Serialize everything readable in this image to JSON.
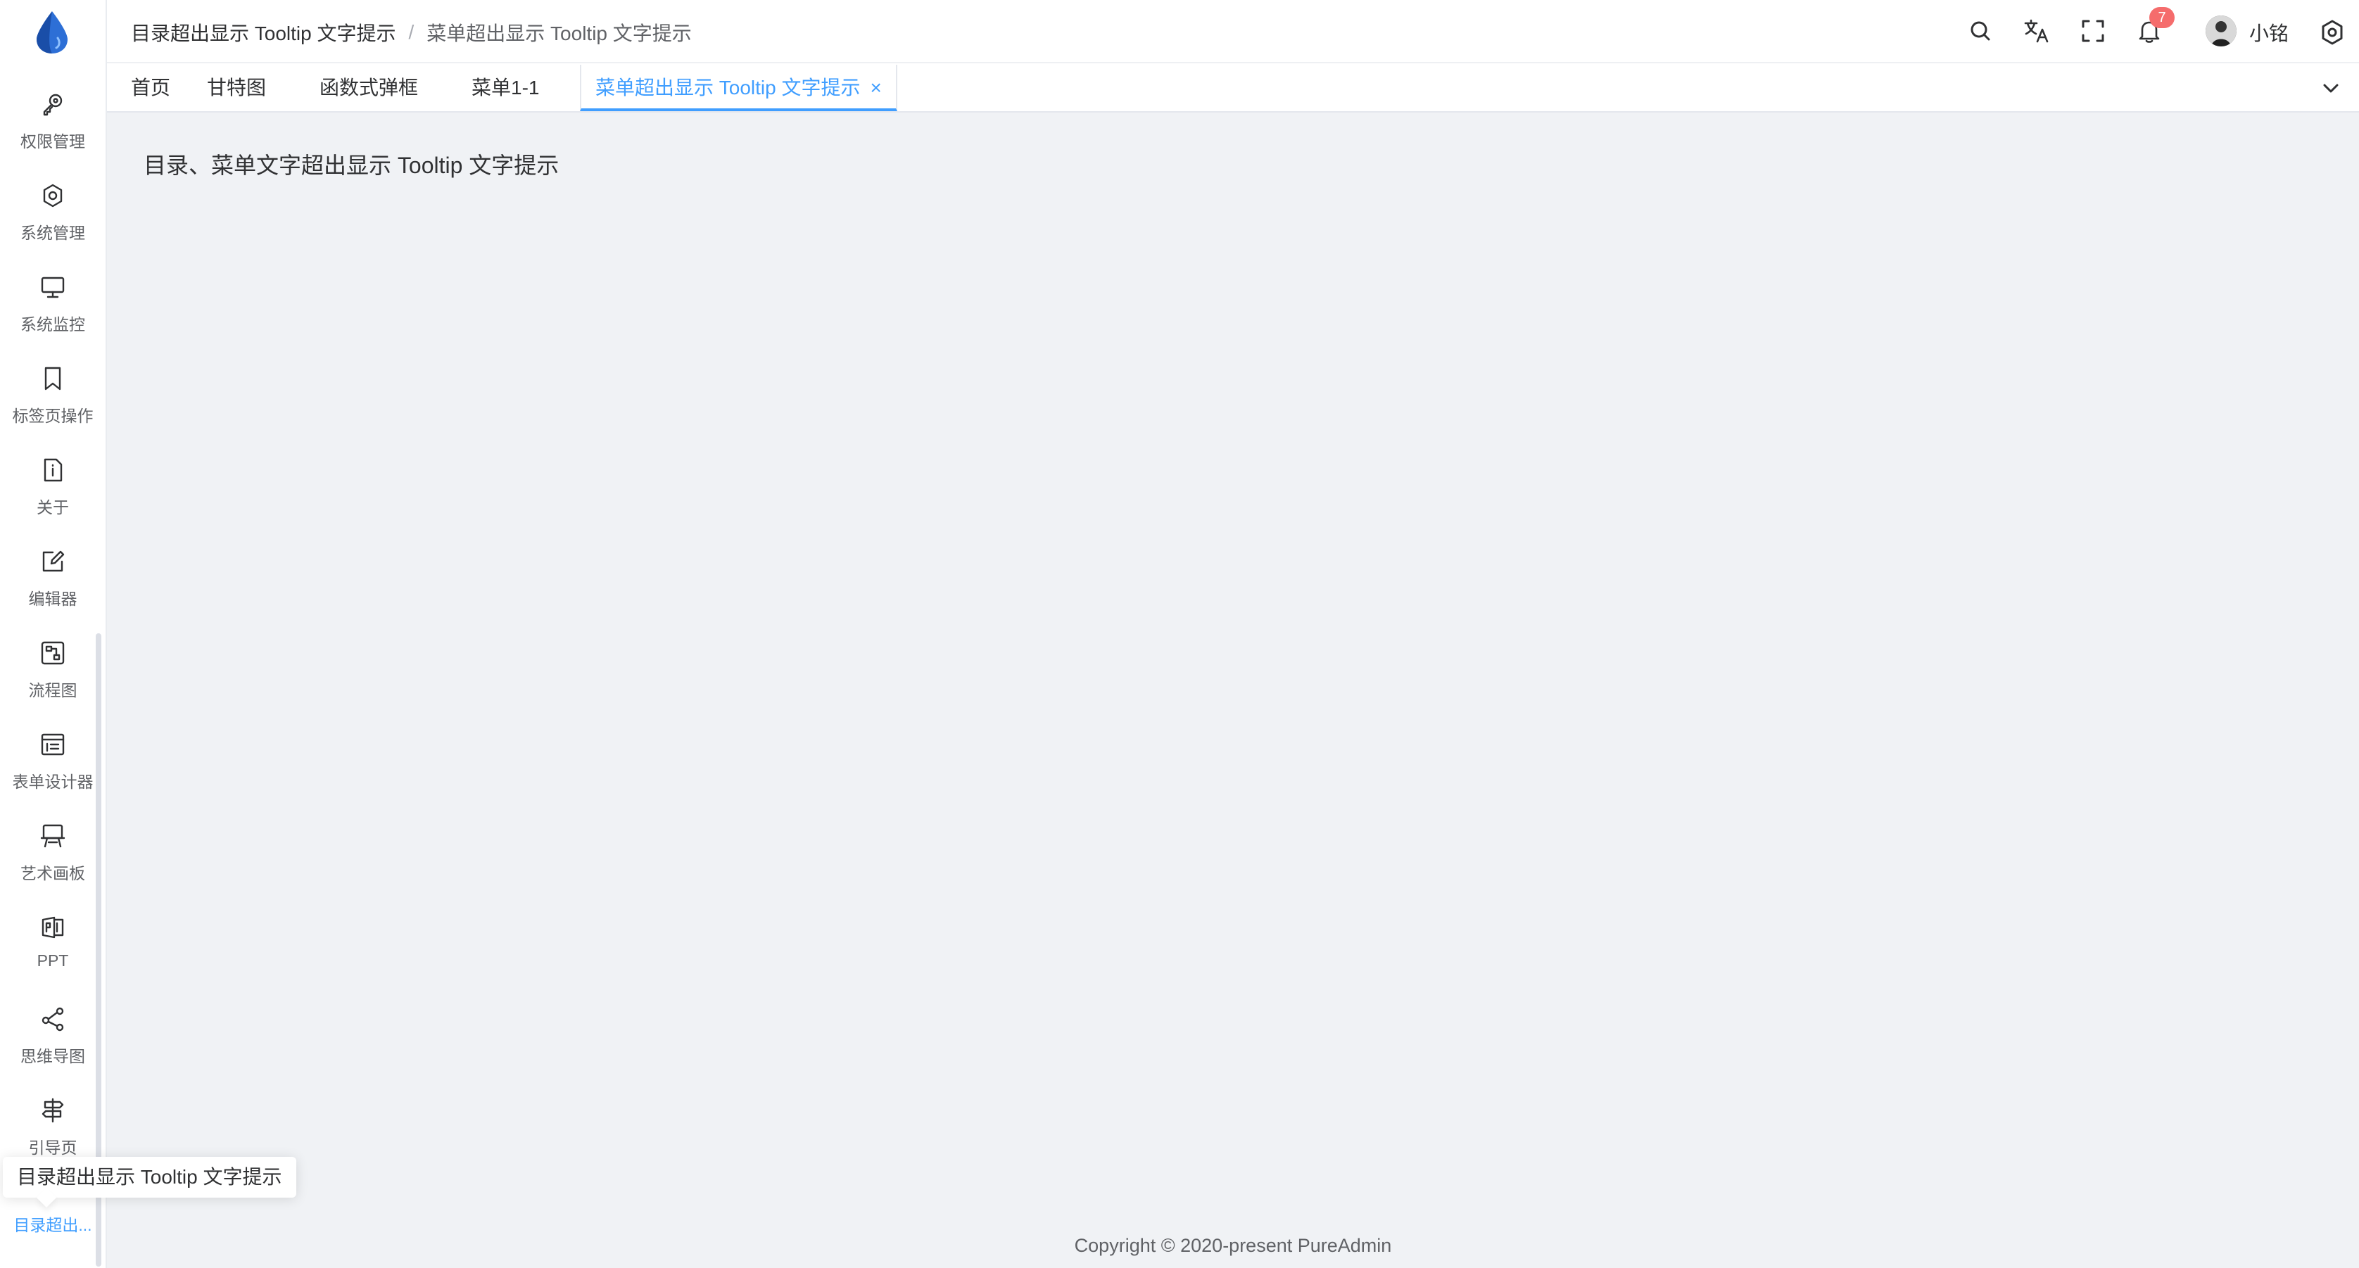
{
  "sidebar": {
    "items": [
      {
        "label": "权限管理",
        "icon": "key-icon"
      },
      {
        "label": "系统管理",
        "icon": "gear-icon"
      },
      {
        "label": "系统监控",
        "icon": "monitor-icon"
      },
      {
        "label": "标签页操作",
        "icon": "bookmark-icon"
      },
      {
        "label": "关于",
        "icon": "info-file-icon"
      },
      {
        "label": "编辑器",
        "icon": "edit-icon"
      },
      {
        "label": "流程图",
        "icon": "flow-icon"
      },
      {
        "label": "表单设计器",
        "icon": "form-icon"
      },
      {
        "label": "艺术画板",
        "icon": "easel-icon"
      },
      {
        "label": "PPT",
        "icon": "ppt-icon"
      },
      {
        "label": "思维导图",
        "icon": "mindmap-icon"
      },
      {
        "label": "引导页",
        "icon": "signpost-icon"
      },
      {
        "label": "目录超出...",
        "icon": "none"
      }
    ]
  },
  "navbar": {
    "breadcrumb": [
      "目录超出显示 Tooltip 文字提示",
      "菜单超出显示 Tooltip 文字提示"
    ],
    "separator": "/",
    "notification_count": "7",
    "username": "小铭"
  },
  "tabs": [
    {
      "label": "首页"
    },
    {
      "label": "甘特图"
    },
    {
      "label": "函数式弹框"
    },
    {
      "label": "菜单1-1"
    },
    {
      "label": "菜单超出显示 Tooltip 文字提示",
      "close": "×"
    }
  ],
  "main": {
    "title": "目录、菜单文字超出显示 Tooltip 文字提示",
    "footer": "Copyright © 2020-present PureAdmin"
  },
  "tooltip": {
    "text": "目录超出显示 Tooltip 文字提示"
  },
  "colors": {
    "accent": "#409eff",
    "badge": "#f56c6c",
    "background": "#f0f2f5"
  }
}
